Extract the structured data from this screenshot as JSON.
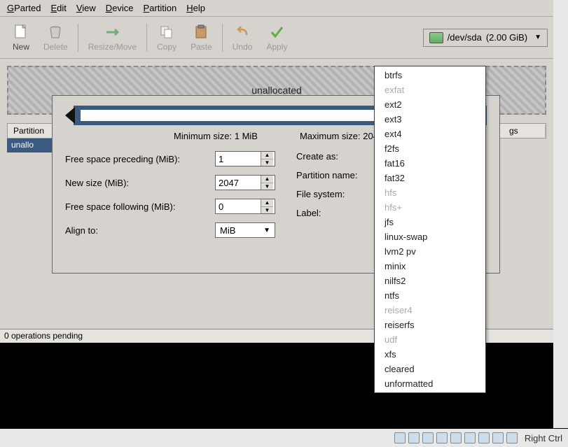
{
  "menubar": [
    "GParted",
    "Edit",
    "View",
    "Device",
    "Partition",
    "Help"
  ],
  "toolbar": {
    "new": "New",
    "delete": "Delete",
    "resize": "Resize/Move",
    "copy": "Copy",
    "paste": "Paste",
    "undo": "Undo",
    "apply": "Apply"
  },
  "device": {
    "path": "/dev/sda",
    "size": "(2.00 GiB)"
  },
  "alloc_label": "unallocated",
  "table": {
    "col_partition": "Partition",
    "col_flags": "gs",
    "row0": "unallo"
  },
  "dialog": {
    "min": "Minimum size: 1 MiB",
    "max": "Maximum size: 204",
    "free_preceding_label": "Free space preceding (MiB):",
    "free_preceding_value": "1",
    "new_size_label": "New size (MiB):",
    "new_size_value": "2047",
    "free_following_label": "Free space following (MiB):",
    "free_following_value": "0",
    "align_label": "Align to:",
    "align_value": "MiB",
    "create_as_label": "Create as:",
    "partition_name_label": "Partition name:",
    "file_system_label": "File system:",
    "label_label": "Label:"
  },
  "fs_options": [
    {
      "t": "btrfs",
      "d": false
    },
    {
      "t": "exfat",
      "d": true
    },
    {
      "t": "ext2",
      "d": false
    },
    {
      "t": "ext3",
      "d": false
    },
    {
      "t": "ext4",
      "d": false
    },
    {
      "t": "f2fs",
      "d": false
    },
    {
      "t": "fat16",
      "d": false
    },
    {
      "t": "fat32",
      "d": false
    },
    {
      "t": "hfs",
      "d": true
    },
    {
      "t": "hfs+",
      "d": true
    },
    {
      "t": "jfs",
      "d": false
    },
    {
      "t": "linux-swap",
      "d": false
    },
    {
      "t": "lvm2 pv",
      "d": false
    },
    {
      "t": "minix",
      "d": false
    },
    {
      "t": "nilfs2",
      "d": false
    },
    {
      "t": "ntfs",
      "d": false
    },
    {
      "t": "reiser4",
      "d": true
    },
    {
      "t": "reiserfs",
      "d": false
    },
    {
      "t": "udf",
      "d": true
    },
    {
      "t": "xfs",
      "d": false
    },
    {
      "t": "cleared",
      "d": false
    },
    {
      "t": "unformatted",
      "d": false
    }
  ],
  "status": "0 operations pending",
  "vm_key": "Right Ctrl"
}
